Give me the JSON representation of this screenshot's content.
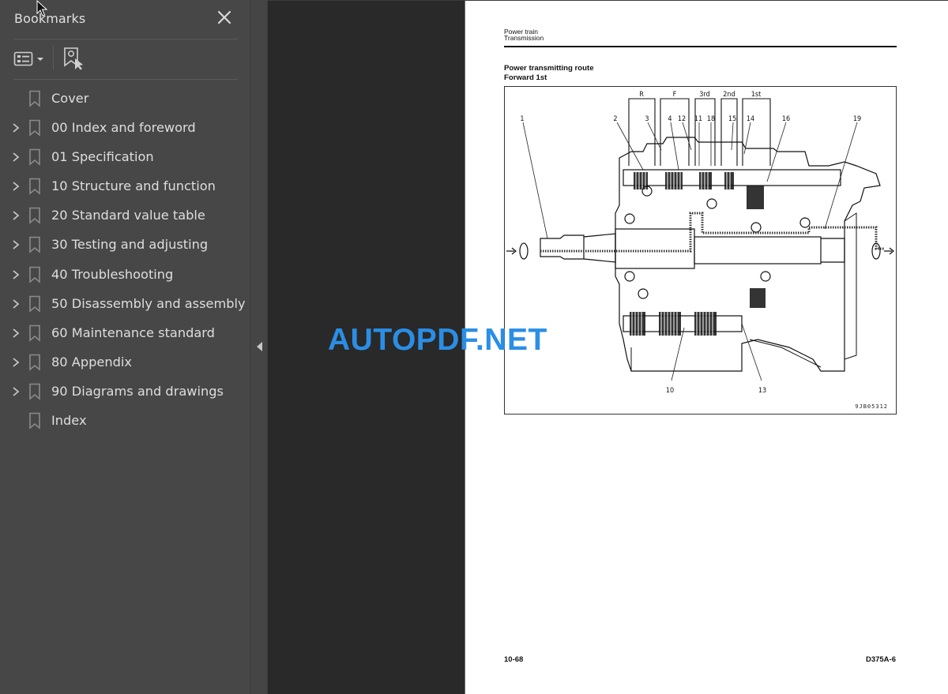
{
  "sidebar": {
    "title": "Bookmarks",
    "close_icon": "close-icon",
    "toolbar": {
      "options_icon": "list-options-icon",
      "options_dropdown_icon": "caret-down-icon",
      "find_bookmark_icon": "find-current-bookmark-icon"
    },
    "bookmarks": [
      {
        "label": "Cover",
        "expandable": false
      },
      {
        "label": "00 Index and foreword",
        "expandable": true
      },
      {
        "label": "01 Specification",
        "expandable": true
      },
      {
        "label": "10 Structure and function",
        "expandable": true
      },
      {
        "label": "20 Standard value table",
        "expandable": true
      },
      {
        "label": "30 Testing and adjusting",
        "expandable": true
      },
      {
        "label": "40 Troubleshooting",
        "expandable": true
      },
      {
        "label": "50 Disassembly and assembly",
        "expandable": true
      },
      {
        "label": "60 Maintenance standard",
        "expandable": true
      },
      {
        "label": "80 Appendix",
        "expandable": true
      },
      {
        "label": "90 Diagrams and drawings",
        "expandable": true
      },
      {
        "label": "Index",
        "expandable": false
      }
    ]
  },
  "collapse_handle": {
    "icon": "triangle-left-icon"
  },
  "page": {
    "header_line1": "Power train",
    "header_line2": "Transmission",
    "section_title": "Power transmitting route",
    "section_subtitle": "Forward 1st",
    "figure": {
      "clutch_labels": [
        "R",
        "F",
        "3rd",
        "2nd",
        "1st"
      ],
      "callouts": [
        "1",
        "2",
        "3",
        "4",
        "12",
        "11",
        "18",
        "15",
        "14",
        "16",
        "19",
        "10",
        "13"
      ],
      "figure_code": "9JB05312"
    },
    "footer_left": "10-68",
    "footer_right": "D375A-6"
  },
  "watermark": "AUTOPDF.NET",
  "colors": {
    "sidebar_bg": "#474747",
    "viewer_bg": "#292929",
    "watermark": "#2a8ee6"
  }
}
